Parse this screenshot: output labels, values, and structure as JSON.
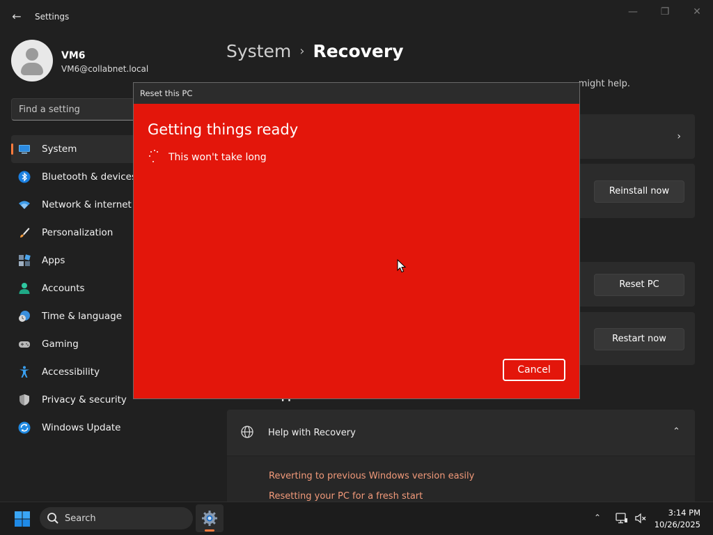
{
  "window": {
    "title": "Settings",
    "back_glyph": "←",
    "minimize_glyph": "—",
    "maximize_glyph": "❐",
    "close_glyph": "✕"
  },
  "profile": {
    "name": "VM6",
    "email": "VM6@collabnet.local"
  },
  "search": {
    "placeholder": "Find a setting"
  },
  "nav": {
    "items": [
      {
        "label": "System",
        "icon": "monitor-icon",
        "active": true
      },
      {
        "label": "Bluetooth & devices",
        "icon": "bluetooth-icon"
      },
      {
        "label": "Network & internet",
        "icon": "wifi-icon"
      },
      {
        "label": "Personalization",
        "icon": "brush-icon"
      },
      {
        "label": "Apps",
        "icon": "apps-icon"
      },
      {
        "label": "Accounts",
        "icon": "person-icon"
      },
      {
        "label": "Time & language",
        "icon": "globe-clock-icon"
      },
      {
        "label": "Gaming",
        "icon": "gamepad-icon"
      },
      {
        "label": "Accessibility",
        "icon": "accessibility-icon"
      },
      {
        "label": "Privacy & security",
        "icon": "shield-icon"
      },
      {
        "label": "Windows Update",
        "icon": "update-icon"
      }
    ]
  },
  "main": {
    "breadcrumb_parent": "System",
    "breadcrumb_separator": "›",
    "breadcrumb_current": "Recovery",
    "intro_visible": "might help.",
    "reinstall_button": "Reinstall now",
    "reset_button": "Reset PC",
    "restart_button": "Restart now",
    "chevron_right": "›",
    "related_support_partial": "Related support",
    "help_title": "Help with Recovery",
    "chevron_up": "⌃",
    "help_links": [
      "Reverting to previous Windows version easily",
      "Resetting your PC for a fresh start"
    ]
  },
  "dialog": {
    "title": "Reset this PC",
    "heading": "Getting things ready",
    "subtext": "This won't take long",
    "cancel_label": "Cancel",
    "background_color": "#e3160b"
  },
  "taskbar": {
    "search_label": "Search",
    "tray_chevron": "⌃",
    "time": "3:14 PM",
    "date": "10/26/2025",
    "accent_color": "#ff7b3d"
  }
}
